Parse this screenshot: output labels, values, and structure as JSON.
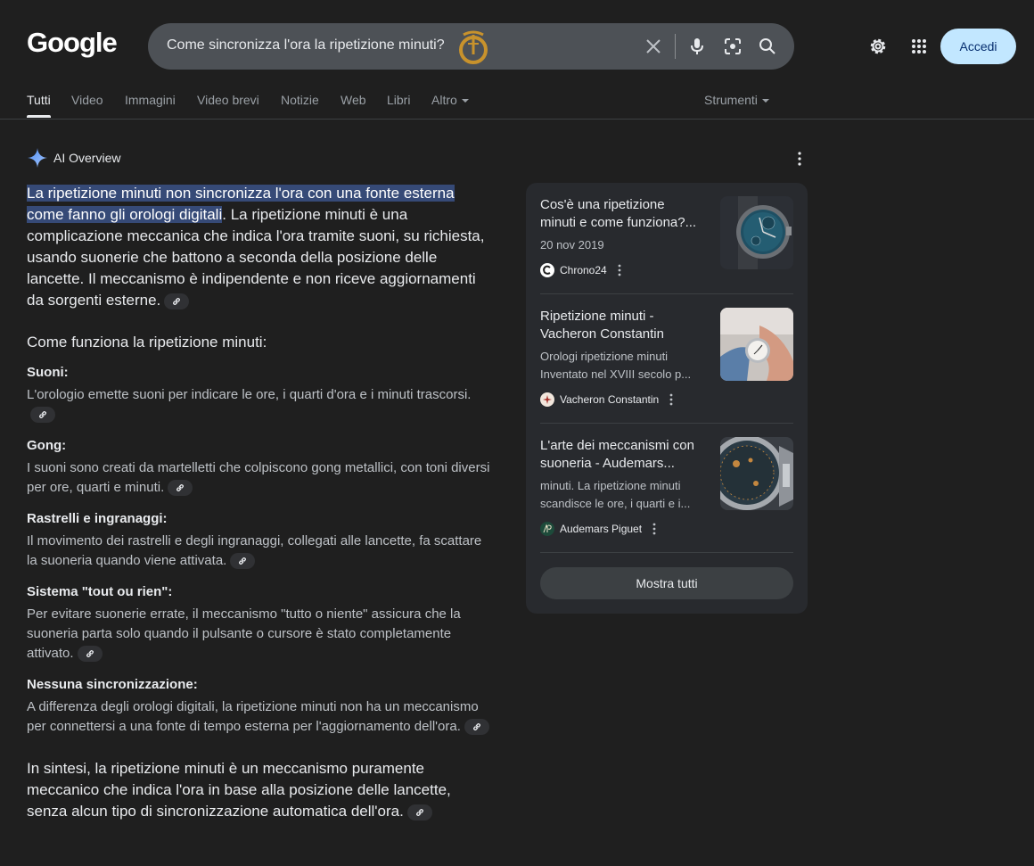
{
  "header": {
    "logo": "Google",
    "search_query": "Come sincronizza l'ora la ripetizione minuti?",
    "sign_in": "Accedi"
  },
  "tabs": [
    {
      "label": "Tutti",
      "active": true
    },
    {
      "label": "Video"
    },
    {
      "label": "Immagini"
    },
    {
      "label": "Video brevi"
    },
    {
      "label": "Notizie"
    },
    {
      "label": "Web"
    },
    {
      "label": "Libri"
    },
    {
      "label": "Altro"
    }
  ],
  "tools_label": "Strumenti",
  "ai_overview": {
    "title": "AI Overview",
    "intro_highlight": "La ripetizione minuti non sincronizza l'ora con una fonte esterna come fanno gli orologi digitali",
    "intro_rest": ". La ripetizione minuti è una complicazione meccanica che indica l'ora tramite suoni, su richiesta, usando suonerie che battono a seconda della posizione delle lancette. Il meccanismo è indipendente e non riceve aggiornamenti da sorgenti esterne.",
    "section_heading": "Come funziona la ripetizione minuti:",
    "items": [
      {
        "title": "Suoni:",
        "text": "L'orologio emette suoni per indicare le ore, i quarti d'ora e i minuti trascorsi."
      },
      {
        "title": "Gong:",
        "text": "I suoni sono creati da martelletti che colpiscono gong metallici, con toni diversi per ore, quarti e minuti."
      },
      {
        "title": "Rastrelli e ingranaggi:",
        "text": "Il movimento dei rastrelli e degli ingranaggi, collegati alle lancette, fa scattare la suoneria quando viene attivata."
      },
      {
        "title": "Sistema \"tout ou rien\":",
        "text": "Per evitare suonerie errate, il meccanismo \"tutto o niente\" assicura che la suoneria parta solo quando il pulsante o cursore è stato completamente attivato."
      },
      {
        "title": "Nessuna sincronizzazione:",
        "text": "A differenza degli orologi digitali, la ripetizione minuti non ha un meccanismo per connettersi a una fonte di tempo esterna per l'aggiornamento dell'ora."
      }
    ],
    "summary": "In sintesi, la ripetizione minuti è un meccanismo puramente meccanico che indica l'ora in base alla posizione delle lancette, senza alcun tipo di sincronizzazione automatica dell'ora."
  },
  "sources": [
    {
      "title_1": "Cos'è una ripetizione",
      "title_2": "minuti e come funziona?...",
      "date": "20 nov 2019",
      "source": "Chrono24"
    },
    {
      "title_1": "Ripetizione minuti -",
      "title_2": "Vacheron Constantin",
      "snippet_1": "Orologi ripetizione minuti",
      "snippet_2": "Inventato nel XVIII secolo p...",
      "source": "Vacheron Constantin"
    },
    {
      "title_1": "L'arte dei meccanismi con",
      "title_2": "suoneria - Audemars...",
      "snippet_1": "minuti. La ripetizione minuti",
      "snippet_2": "scandisce le ore, i quarti e i...",
      "source": "Audemars Piguet"
    }
  ],
  "show_all": "Mostra tutti"
}
